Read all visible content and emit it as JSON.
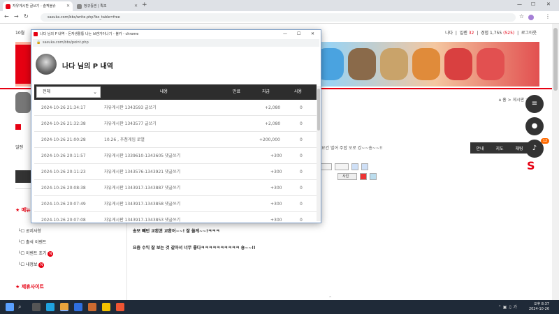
{
  "browser": {
    "tabs": [
      {
        "label": "자유게시판 글쓰기 - 슬픽블슈"
      },
      {
        "label": "정규증권 | 퀵조"
      }
    ],
    "url": "sasuka.com/bbs/write.php?bo_table=free"
  },
  "site": {
    "date_text": "10월",
    "user": {
      "name": "나다",
      "level_label": "일렌",
      "level_value": "32",
      "points_label": "경험",
      "points_value": "1,755",
      "points_extra": "(525)",
      "logout": "로그아웃"
    },
    "breadcrumb": "⌂ 홈 > 게시판 > 자유",
    "sidebar": {
      "level_label": "일렌",
      "menu_header": "메뉴",
      "items": [
        {
          "label": "공지사항"
        },
        {
          "label": "출석 이벤트"
        },
        {
          "label": "이벤트 초기",
          "badge": "N"
        },
        {
          "label": "내정보",
          "badge": "N"
        }
      ],
      "related_header": "★ 제휴사이트"
    },
    "marquee": "~요건 벌어 주랍 오로 갔~~숑~~!!",
    "tabs_right": [
      "안내",
      "지도",
      "채팅"
    ],
    "chat_badge": "12",
    "post_lines": [
      "송모 빼던 교환권 교환어~~! 잘 쓸게~~!ㅋㅋㅋ",
      "요즘 수익 잘 보는 것 같아서 너무 좋다ㅋㅋㅋㅋㅋㅋㅋㅋㅋㅋ 숑~~!!"
    ],
    "editor_buttons": [
      "사진"
    ]
  },
  "popup": {
    "window_title": "나다 님의 P 내역 - 돈자생활통 나는 브랜가이나기 - 볼카 - chrome",
    "url": "sasuka.com/bbs/point.php",
    "heading": "나다 님의 P 내역",
    "filter_value": "전체",
    "columns": [
      "내용",
      "만료",
      "지급",
      "사용"
    ],
    "rows": [
      {
        "date": "2024-10-26 21:34:17",
        "desc": "자유게시판 1343593 글쓰기",
        "expire": "",
        "pay": "+2,080",
        "use": "0"
      },
      {
        "date": "2024-10-26 21:32:38",
        "desc": "자유게시판 1343577 글쓰기",
        "expire": "",
        "pay": "+2,080",
        "use": "0"
      },
      {
        "date": "2024-10-26 21:00:28",
        "desc": "10.26 , 추첨게임 로열",
        "expire": "",
        "pay": "+200,000",
        "use": "0"
      },
      {
        "date": "2024-10-26 20:11:57",
        "desc": "자유게시판 1339610-1343605 댓글쓰기",
        "expire": "",
        "pay": "+300",
        "use": "0"
      },
      {
        "date": "2024-10-26 20:11:23",
        "desc": "자유게시판 1343576-1343921 댓글쓰기",
        "expire": "",
        "pay": "+300",
        "use": "0"
      },
      {
        "date": "2024-10-26 20:08:38",
        "desc": "자유게시판 1343917-1343887 댓글쓰기",
        "expire": "",
        "pay": "+300",
        "use": "0"
      },
      {
        "date": "2024-10-26 20:07:49",
        "desc": "자유게시판 1343917-1343858 댓글쓰기",
        "expire": "",
        "pay": "+300",
        "use": "0"
      },
      {
        "date": "2024-10-26 20:07:08",
        "desc": "자유게시판 1343917-1343853 댓글쓰기",
        "expire": "",
        "pay": "+300",
        "use": "0"
      }
    ]
  },
  "taskbar": {
    "time": "오후 8:37",
    "date": "2024-10-26"
  }
}
